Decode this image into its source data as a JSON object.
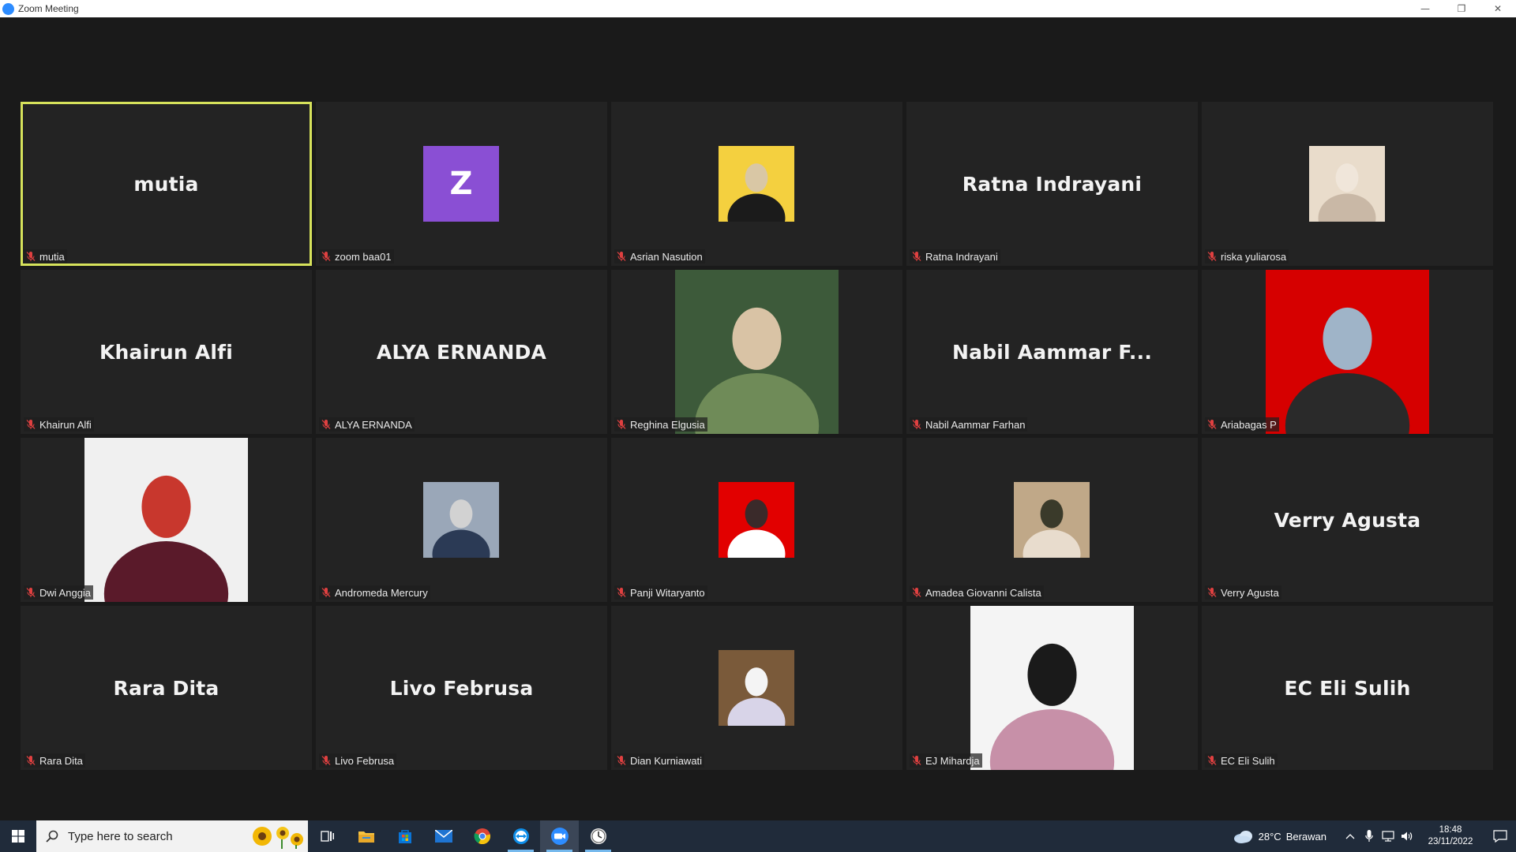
{
  "window": {
    "title": "Zoom Meeting",
    "minimize_icon": "minimize-icon",
    "restore_icon": "restore-icon",
    "close_icon": "close-icon"
  },
  "participants": [
    {
      "display": "mutia",
      "label": "mutia",
      "type": "name",
      "muted": true,
      "active_speaker": true
    },
    {
      "display": "Z",
      "label": "zoom baa01",
      "type": "letter",
      "muted": true,
      "color": "#8a4fd4"
    },
    {
      "label": "Asrian Nasution",
      "type": "photo",
      "muted": true
    },
    {
      "display": "Ratna Indrayani",
      "label": "Ratna Indrayani",
      "type": "name",
      "muted": true
    },
    {
      "label": "riska yuliarosa",
      "type": "photo",
      "muted": true
    },
    {
      "display": "Khairun Alfi",
      "label": "Khairun Alfi",
      "type": "name",
      "muted": true
    },
    {
      "display": "ALYA ERNANDA",
      "label": "ALYA ERNANDA",
      "type": "name",
      "muted": true
    },
    {
      "label": "Reghina Elgusia",
      "type": "photo-tall",
      "muted": true
    },
    {
      "display": "Nabil Aammar F...",
      "label": "Nabil Aammar Farhan",
      "type": "name",
      "muted": true
    },
    {
      "label": "Ariabagas P",
      "type": "photo-tall",
      "muted": true
    },
    {
      "label": "Dwi Anggia",
      "type": "photo-tall",
      "muted": true
    },
    {
      "label": "Andromeda Mercury",
      "type": "photo",
      "muted": true
    },
    {
      "label": "Panji Witaryanto",
      "type": "photo",
      "muted": true
    },
    {
      "label": "Amadea Giovanni Calista",
      "type": "photo",
      "muted": true
    },
    {
      "display": "Verry Agusta",
      "label": "Verry Agusta",
      "type": "name",
      "muted": true
    },
    {
      "display": "Rara Dita",
      "label": "Rara Dita",
      "type": "name",
      "muted": true
    },
    {
      "display": "Livo Februsa",
      "label": "Livo Februsa",
      "type": "name",
      "muted": true
    },
    {
      "label": "Dian Kurniawati",
      "type": "photo",
      "muted": true
    },
    {
      "label": "EJ Mihardja",
      "type": "photo-tall",
      "muted": true
    },
    {
      "display": "EC Eli Sulih",
      "label": "EC Eli Sulih",
      "type": "name",
      "muted": true
    }
  ],
  "taskbar": {
    "search_placeholder": "Type here to search",
    "apps": [
      "task-view-icon",
      "file-explorer-icon",
      "store-icon",
      "mail-icon",
      "chrome-icon",
      "teamviewer-icon",
      "zoom-icon",
      "clock-app-icon"
    ],
    "weather": {
      "temp": "28°C",
      "condition": "Berawan"
    },
    "time": "18:48",
    "date": "23/11/2022"
  },
  "colors": {
    "active_speaker_border": "#d6e25b",
    "muted_icon": "#e04040",
    "tile_bg": "#232323",
    "stage_bg": "#1a1a1a",
    "taskbar_bg": "#202b3a"
  }
}
